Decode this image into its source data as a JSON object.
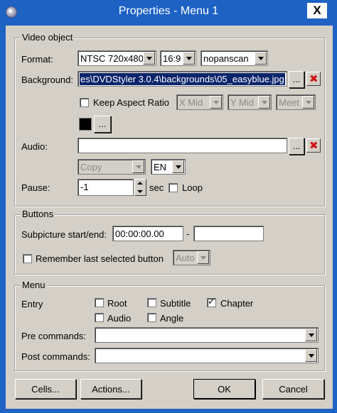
{
  "window": {
    "title": "Properties - Menu 1",
    "close_glyph": "X"
  },
  "video": {
    "group_title": "Video object",
    "format_label": "Format:",
    "format_value": "NTSC 720x480",
    "aspect_value": "16:9",
    "scan_value": "nopanscan",
    "background_label": "Background:",
    "background_value": "es\\DVDStyler 3.0.4\\backgrounds\\05_easyblue.jpg",
    "browse_label": "...",
    "keep_aspect_label": "Keep Aspect Ratio",
    "x_mid": "X Mid",
    "y_mid": "Y Mid",
    "meet": "Meet",
    "color_button_label": "...",
    "audio_label": "Audio:",
    "audio_value": "",
    "audio_browse_label": "...",
    "copy_value": "Copy",
    "lang_value": "EN",
    "pause_label": "Pause:",
    "pause_value": "-1",
    "sec_label": "sec",
    "loop_label": "Loop"
  },
  "buttons": {
    "group_title": "Buttons",
    "subpicture_label": "Subpicture start/end:",
    "start_value": "00:00:00.00",
    "dash": "-",
    "end_value": "",
    "remember_label": "Remember last selected button",
    "auto_value": "Auto"
  },
  "menu": {
    "group_title": "Menu",
    "entry_label": "Entry",
    "root_label": "Root",
    "subtitle_label": "Subtitle",
    "chapter_label": "Chapter",
    "audio_label": "Audio",
    "angle_label": "Angle",
    "pre_label": "Pre commands:",
    "pre_value": "",
    "post_label": "Post commands:",
    "post_value": ""
  },
  "footer": {
    "cells_label": "Cells...",
    "actions_label": "Actions...",
    "ok_label": "OK",
    "cancel_label": "Cancel"
  },
  "colors": {
    "titlebar": "#1e62c4",
    "dialog_bg": "#d4d0c8",
    "selection": "#0a246a",
    "delete_red": "#d01818"
  },
  "state": {
    "keep_aspect": false,
    "loop": false,
    "remember_last": false,
    "root": false,
    "subtitle": false,
    "chapter": true,
    "audio": false,
    "angle": false
  }
}
